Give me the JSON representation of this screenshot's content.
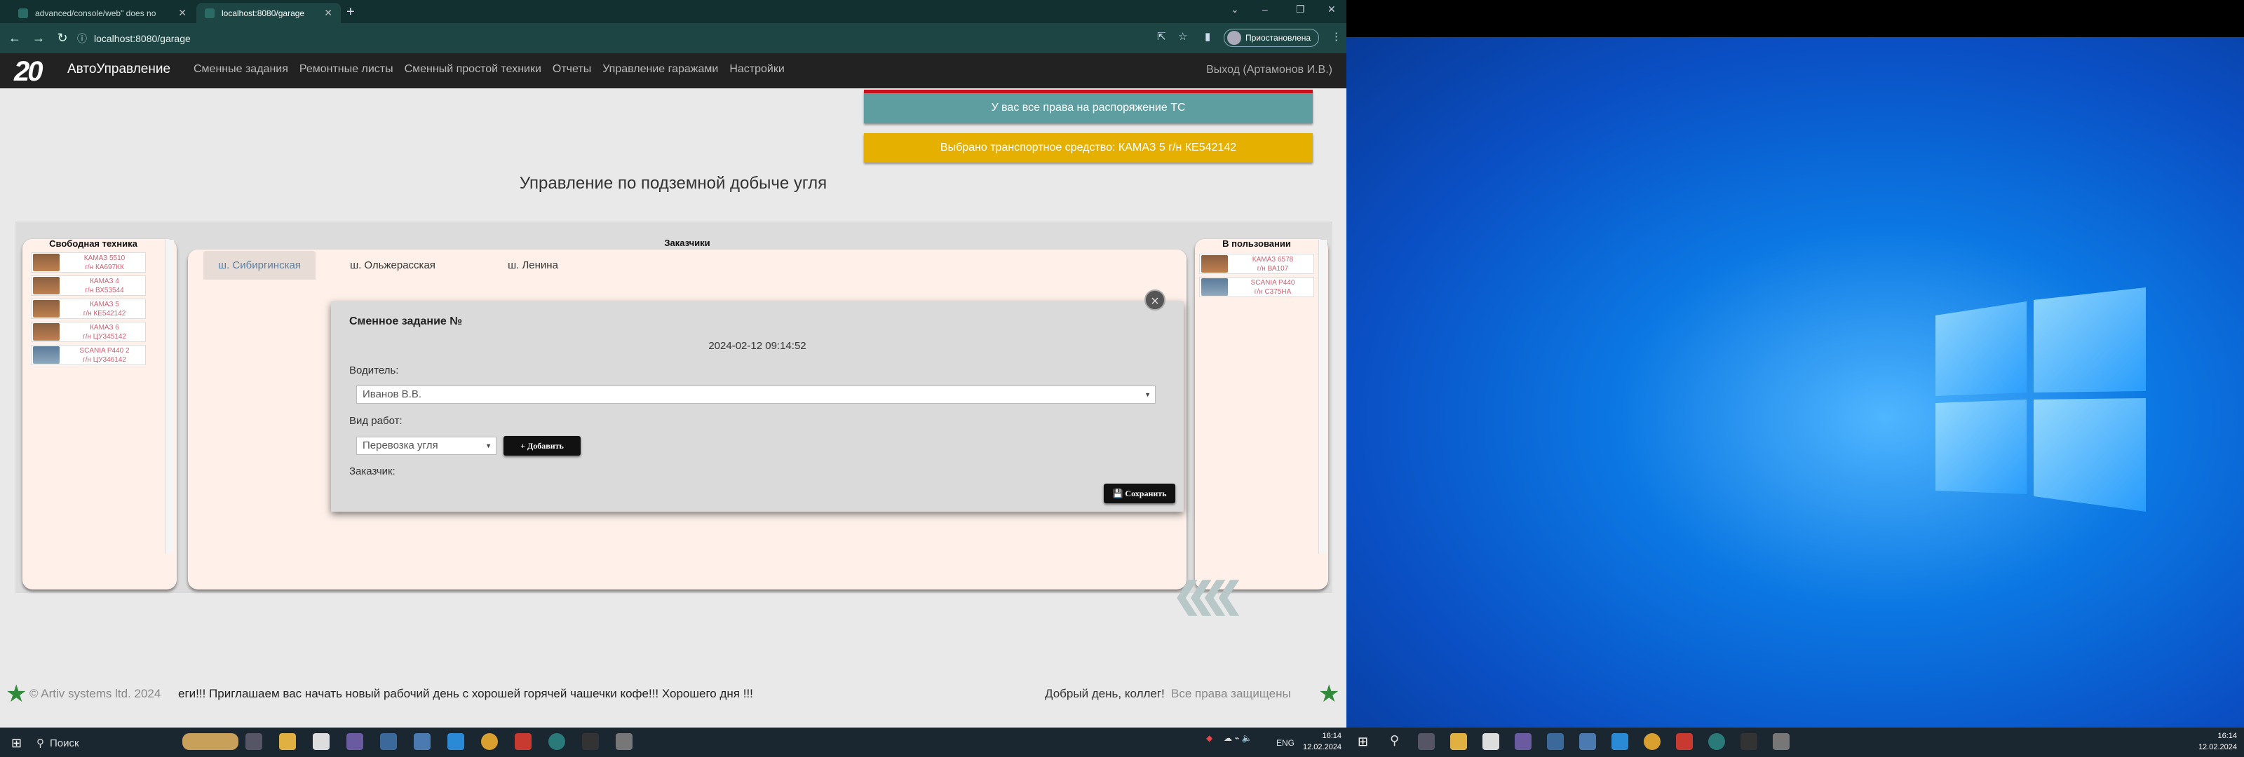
{
  "browser": {
    "tabs": [
      {
        "title": "advanced/console/web\" does no"
      },
      {
        "title": "localhost:8080/garage"
      }
    ],
    "url": "localhost:8080/garage",
    "profile": "Приостановлена"
  },
  "app": {
    "brand": "АвтоУправление",
    "logo": "20",
    "nav": [
      "Сменные задания",
      "Ремонтные листы",
      "Сменный простой техники",
      "Отчеты",
      "Управление гаражами",
      "Настройки"
    ],
    "logout": "Выход (Артамонов И.В.)"
  },
  "alerts": {
    "rights": "У вас все права на распоряжение ТС",
    "selected": "Выбрано транспортное средство: КАМАЗ 5 г/н КЕ542142"
  },
  "page_title": "Управление по подземной добыче угля",
  "free_vehicles": {
    "title": "Свободная техника",
    "items": [
      {
        "model": "КАМАЗ 5510",
        "plate": "г/н КА697КК"
      },
      {
        "model": "КАМАЗ 4",
        "plate": "г/н ВХ53544"
      },
      {
        "model": "КАМАЗ 5",
        "plate": "г/н КЕ542142"
      },
      {
        "model": "КАМАЗ 6",
        "plate": "г/н ЦУ345142"
      },
      {
        "model": "SCANIA P440 2",
        "plate": "г/н ЦУ346142"
      }
    ]
  },
  "customers": {
    "title": "Заказчики",
    "tabs": [
      "ш. Сибиргинская",
      "ш. Ольжерасская",
      "ш. Ленина"
    ]
  },
  "in_use": {
    "title": "В пользовании",
    "items": [
      {
        "model": "КАМАЗ 6578",
        "plate": "г/н ВА107"
      },
      {
        "model": "SCANIA P440",
        "plate": "г/н С375НА"
      }
    ]
  },
  "modal": {
    "title": "Сменное задание №",
    "datetime": "2024-02-12 09:14:52",
    "driver_label": "Водитель:",
    "driver_value": "Иванов В.В.",
    "work_label": "Вид работ:",
    "work_value": "Перевозка угля",
    "add_button": "+ Добавить",
    "customer_label": "Заказчик:",
    "save_button": "💾 Сохранить",
    "close": "×"
  },
  "footer": {
    "copyright": "© Artiv systems ltd. 2024",
    "marquee": "еги!!! Приглашаем вас начать новый рабочий день с хорошей горячей чашечки кофе!!! Хорошего дня !!!",
    "greeting": "Добрый день, коллег!",
    "rights": "Все права защищены"
  },
  "taskbar": {
    "search": "Поиск",
    "lang": "ENG",
    "time": "16:14",
    "date": "12.02.2024"
  },
  "colors": {
    "chrome_dark": "#12302f",
    "alert_teal": "#5f9ea0",
    "alert_yellow": "#e6b000",
    "panel_bg": "#fff1ea"
  }
}
